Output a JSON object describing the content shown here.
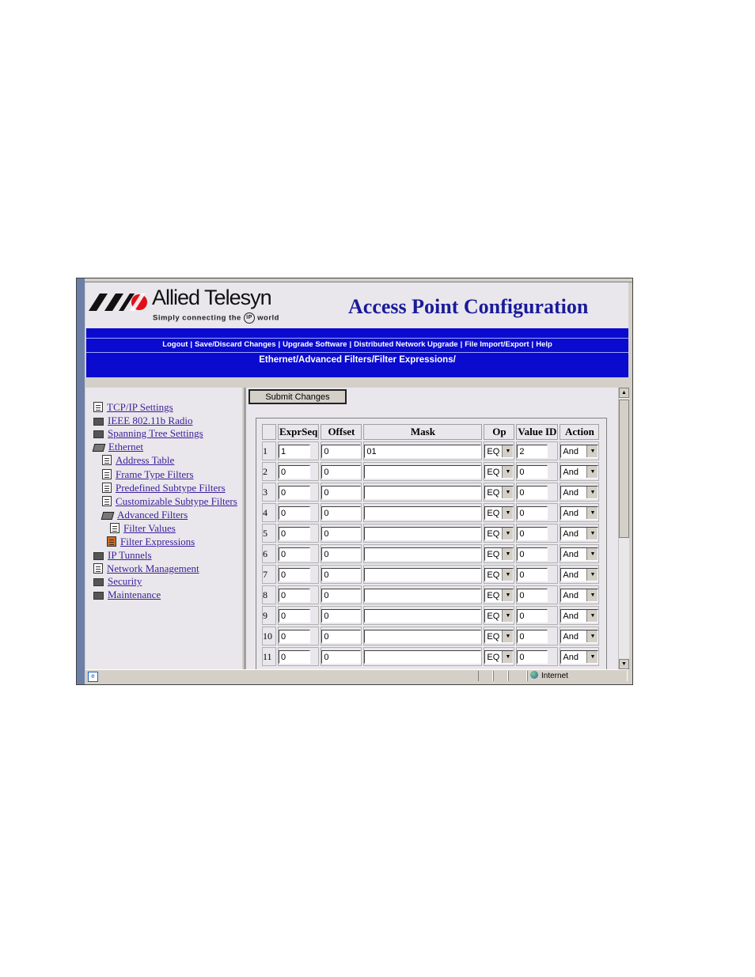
{
  "header": {
    "logo_name": "Allied Telesyn",
    "logo_tagline_pre": "Simply connecting the",
    "logo_tagline_ip": "IP",
    "logo_tagline_post": "world",
    "app_title": "Access Point Configuration"
  },
  "nav": {
    "links": [
      "Logout",
      "Save/Discard Changes",
      "Upgrade Software",
      "Distributed Network Upgrade",
      "File Import/Export",
      "Help"
    ],
    "breadcrumb": "Ethernet/Advanced Filters/Filter Expressions/"
  },
  "tree": {
    "items": [
      {
        "label": "TCP/IP Settings",
        "icon": "document-icon"
      },
      {
        "label": "IEEE 802.11b Radio",
        "icon": "folder-icon"
      },
      {
        "label": "Spanning Tree Settings",
        "icon": "document-icon"
      },
      {
        "label": "Ethernet",
        "icon": "folder-open-icon"
      },
      {
        "label": "Address Table",
        "icon": "document-icon"
      },
      {
        "label": "Frame Type Filters",
        "icon": "document-icon"
      },
      {
        "label": "Predefined Subtype Filters",
        "icon": "document-icon"
      },
      {
        "label": "Customizable Subtype Filters",
        "icon": "document-icon"
      },
      {
        "label": "Advanced Filters",
        "icon": "folder-open-icon"
      },
      {
        "label": "Filter Values",
        "icon": "document-icon"
      },
      {
        "label": "Filter Expressions",
        "icon": "document-icon",
        "active": true
      },
      {
        "label": "IP Tunnels",
        "icon": "folder-icon"
      },
      {
        "label": "Network Management",
        "icon": "document-icon"
      },
      {
        "label": "Security",
        "icon": "folder-icon"
      },
      {
        "label": "Maintenance",
        "icon": "folder-icon"
      }
    ]
  },
  "content": {
    "submit_label": "Submit Changes",
    "columns": [
      "ExprSeq",
      "Offset",
      "Mask",
      "Op",
      "Value ID",
      "Action"
    ],
    "rows": [
      {
        "num": "1",
        "exprseq": "1",
        "offset": "0",
        "mask": "01",
        "op": "EQ",
        "value_id": "2",
        "action": "And"
      },
      {
        "num": "2",
        "exprseq": "0",
        "offset": "0",
        "mask": "",
        "op": "EQ",
        "value_id": "0",
        "action": "And"
      },
      {
        "num": "3",
        "exprseq": "0",
        "offset": "0",
        "mask": "",
        "op": "EQ",
        "value_id": "0",
        "action": "And"
      },
      {
        "num": "4",
        "exprseq": "0",
        "offset": "0",
        "mask": "",
        "op": "EQ",
        "value_id": "0",
        "action": "And"
      },
      {
        "num": "5",
        "exprseq": "0",
        "offset": "0",
        "mask": "",
        "op": "EQ",
        "value_id": "0",
        "action": "And"
      },
      {
        "num": "6",
        "exprseq": "0",
        "offset": "0",
        "mask": "",
        "op": "EQ",
        "value_id": "0",
        "action": "And"
      },
      {
        "num": "7",
        "exprseq": "0",
        "offset": "0",
        "mask": "",
        "op": "EQ",
        "value_id": "0",
        "action": "And"
      },
      {
        "num": "8",
        "exprseq": "0",
        "offset": "0",
        "mask": "",
        "op": "EQ",
        "value_id": "0",
        "action": "And"
      },
      {
        "num": "9",
        "exprseq": "0",
        "offset": "0",
        "mask": "",
        "op": "EQ",
        "value_id": "0",
        "action": "And"
      },
      {
        "num": "10",
        "exprseq": "0",
        "offset": "0",
        "mask": "",
        "op": "EQ",
        "value_id": "0",
        "action": "And"
      },
      {
        "num": "11",
        "exprseq": "0",
        "offset": "0",
        "mask": "",
        "op": "EQ",
        "value_id": "0",
        "action": "And"
      }
    ]
  },
  "status": {
    "zone_label": "Internet",
    "icons": [
      "ie-page-icon",
      "globe-icon"
    ]
  },
  "colors": {
    "nav_blue": "#0b0bd0",
    "title_blue": "#1a1a99",
    "link_purple": "#3b1e9a",
    "logo_red": "#e0101a"
  }
}
